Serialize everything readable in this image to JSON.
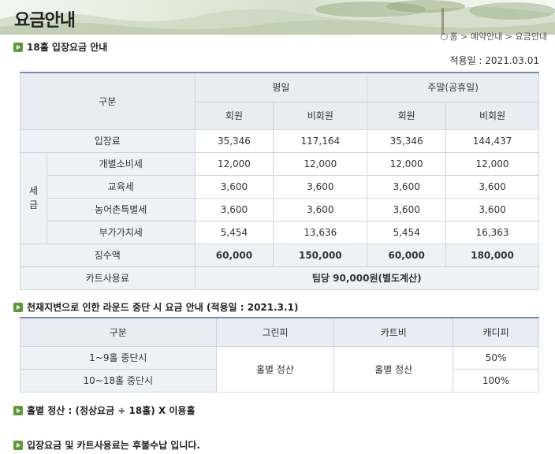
{
  "page": {
    "title": "요금안내",
    "breadcrumb": "홈 > 예약안내 > 요금안내",
    "home_icon": "home-icon"
  },
  "section1": {
    "title": "18홀 입장요금 안내",
    "apply_date": "적용일 : 2021.03.01",
    "header": {
      "category": "구분",
      "weekday": "평일",
      "weekend": "주말(공휴일)",
      "member": "회원",
      "nonmember": "비회원"
    },
    "entry": {
      "label": "입장료",
      "values": [
        "35,346",
        "117,164",
        "35,346",
        "144,437"
      ]
    },
    "tax_label": "세금",
    "taxes": [
      {
        "label": "개별소비세",
        "values": [
          "12,000",
          "12,000",
          "12,000",
          "12,000"
        ]
      },
      {
        "label": "교육세",
        "values": [
          "3,600",
          "3,600",
          "3,600",
          "3,600"
        ]
      },
      {
        "label": "농어촌특별세",
        "values": [
          "3,600",
          "3,600",
          "3,600",
          "3,600"
        ]
      },
      {
        "label": "부가가치세",
        "values": [
          "5,454",
          "13,636",
          "5,454",
          "16,363"
        ]
      }
    ],
    "total": {
      "label": "징수액",
      "values": [
        "60,000",
        "150,000",
        "60,000",
        "180,000"
      ]
    },
    "cart": {
      "label": "카트사용료",
      "value": "팀당 90,000원(별도계산)"
    }
  },
  "section2": {
    "title": "천재지변으로 인한 라운드 중단 시 요금 안내 (적용일 : 2021.3.1)",
    "header": {
      "category": "구분",
      "green": "그린피",
      "cart": "카트비",
      "caddie": "캐디피"
    },
    "rows": [
      {
        "label": "1~9홀 중단시",
        "caddie": "50%"
      },
      {
        "label": "10~18홀 중단시",
        "caddie": "100%"
      }
    ],
    "green_value": "홀별 정산",
    "cart_value": "홀별 정산"
  },
  "notes": {
    "hole_settlement": "홀별 정산 : (정상요금 ÷ 18홀) X 이용홀",
    "postpaid": "입장요금 및 카트사용료는 후불수납 입니다."
  },
  "colors": {
    "accent": "#5a9a3a",
    "header_bg": "#e8edf3",
    "border": "#cfd5dc"
  }
}
